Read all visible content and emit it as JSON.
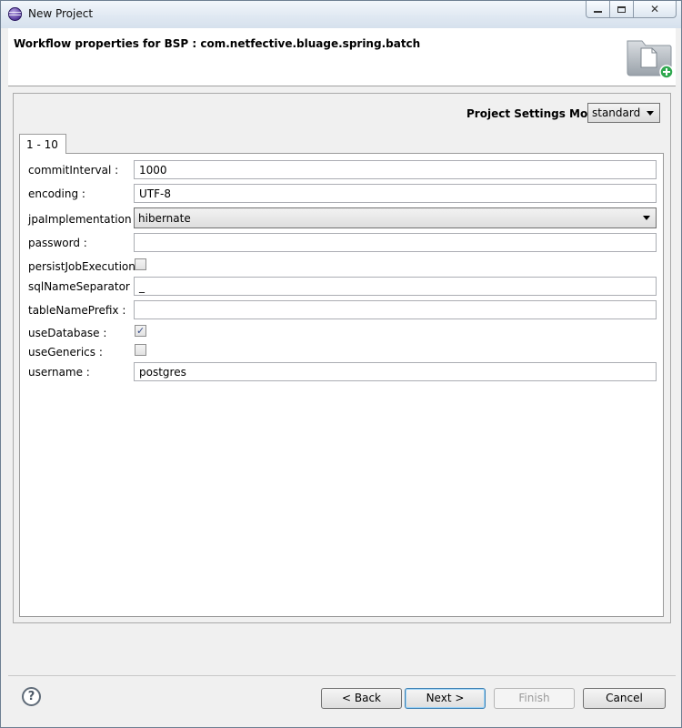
{
  "window": {
    "title": "New Project",
    "buttons": {
      "minimize": "minimize",
      "maximize": "maximize",
      "close": "close"
    }
  },
  "header": {
    "title": "Workflow properties for BSP : com.netfective.bluage.spring.batch",
    "graphic_icon": "new-project-folder-icon"
  },
  "settings": {
    "mode_label": "Project Settings Mode :",
    "mode_value": "standard"
  },
  "tabs": [
    {
      "label": "1 - 10"
    }
  ],
  "form": {
    "commitInterval": {
      "label": "commitInterval :",
      "value": "1000"
    },
    "encoding": {
      "label": "encoding :",
      "value": "UTF-8"
    },
    "jpaImplementation": {
      "label": "jpaImplementation :",
      "value": "hibernate"
    },
    "password": {
      "label": "password :",
      "value": ""
    },
    "persistJobExecution": {
      "label": "persistJobExecution :",
      "checked": false
    },
    "sqlNameSeparator": {
      "label": "sqlNameSeparator :",
      "value": "_"
    },
    "tableNamePrefix": {
      "label": "tableNamePrefix :",
      "value": ""
    },
    "useDatabase": {
      "label": "useDatabase :",
      "checked": true
    },
    "useGenerics": {
      "label": "useGenerics :",
      "checked": false
    },
    "username": {
      "label": "username :",
      "value": "postgres"
    }
  },
  "footer": {
    "help_icon": "?",
    "back": "< Back",
    "next": "Next >",
    "finish": "Finish",
    "cancel": "Cancel"
  }
}
